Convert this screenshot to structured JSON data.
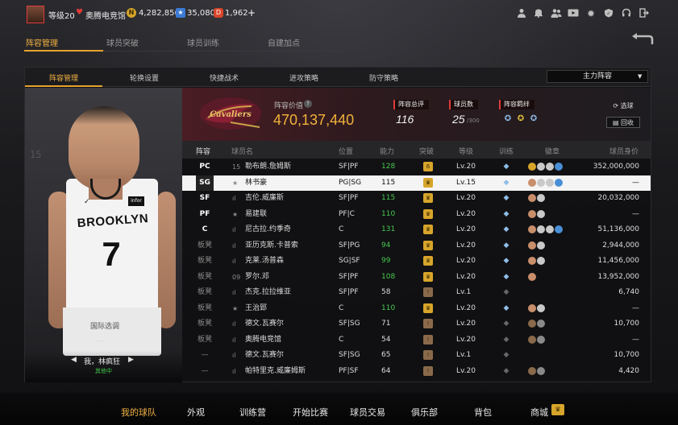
{
  "topbar": {
    "level": "等级20",
    "club_name": "奥腾电竞馆",
    "coins": "4,282,856",
    "gems": "35,080",
    "tickets": "1,962",
    "plus": "+",
    "icons": [
      "profile-icon",
      "bell-icon",
      "friends-icon",
      "video-icon",
      "gear-icon",
      "service-icon",
      "headset-icon",
      "exit-icon"
    ]
  },
  "main_tabs": [
    "阵容管理",
    "球员突破",
    "球员训练",
    "自建加点"
  ],
  "sub_tabs": [
    "阵容管理",
    "轮换设置",
    "快捷战术",
    "进攻策略",
    "防守策略"
  ],
  "dropdown": {
    "value": "主力阵容"
  },
  "player": {
    "name": "我，林疯狂",
    "status": "其他中",
    "shorts_text": "国际选调",
    "dash": "—"
  },
  "team": {
    "value_label": "阵容价值",
    "value": "470,137,440",
    "rating_label": "阵容总评",
    "rating": "116",
    "count_label": "球员数",
    "count": "25",
    "count_max": "/300",
    "talent_label": "阵容羁绊",
    "btn_select": "选球",
    "btn_recycle": "回收"
  },
  "columns": [
    "阵容",
    "球员名",
    "位置",
    "能力",
    "突破",
    "等级",
    "训练",
    "徽章",
    "球员身价"
  ],
  "rows": [
    {
      "pos": "PC",
      "name": "勒布朗.詹姆斯",
      "prefix": "15",
      "posn": "SF|PF",
      "ovr": "128",
      "ovr_green": true,
      "brk": "6",
      "brk_color": "#d7a52a",
      "lvl": "Lv.20",
      "talent": "#8fbde8",
      "emb": [
        "#d7a52a",
        "#c9c9c9",
        "#c9c9c9",
        "#4a8fd6"
      ],
      "price": "352,000,000"
    },
    {
      "pos": "SG",
      "name": "林书豪",
      "prefix": "★",
      "posn": "PG|SG",
      "ovr": "115",
      "ovr_green": false,
      "brk": "♛",
      "brk_color": "#d7a52a",
      "lvl": "Lv.15",
      "talent": "#8fbde8",
      "emb": [
        "#c98e6a",
        "#c9c9c9",
        "#c9c9c9",
        "#4a8fd6"
      ],
      "price": "—",
      "selected": true
    },
    {
      "pos": "SF",
      "name": "吉伦.威廉斯",
      "prefix": "ıl",
      "posn": "SF|PF",
      "ovr": "115",
      "ovr_green": true,
      "brk": "♛",
      "brk_color": "#d7a52a",
      "lvl": "Lv.20",
      "talent": "#8fbde8",
      "emb": [
        "#c98e6a",
        "#c9c9c9"
      ],
      "price": "20,032,000"
    },
    {
      "pos": "PF",
      "name": "易建联",
      "prefix": "★",
      "posn": "PF|C",
      "ovr": "110",
      "ovr_green": true,
      "brk": "♛",
      "brk_color": "#d7a52a",
      "lvl": "Lv.20",
      "talent": "#8fbde8",
      "emb": [
        "#c98e6a",
        "#c9c9c9"
      ],
      "price": "—"
    },
    {
      "pos": "C",
      "name": "尼古拉.约季奇",
      "prefix": "ıl",
      "posn": "C",
      "ovr": "131",
      "ovr_green": true,
      "brk": "♛",
      "brk_color": "#d7a52a",
      "lvl": "Lv.20",
      "talent": "#8fbde8",
      "emb": [
        "#c98e6a",
        "#c9c9c9",
        "#c9c9c9",
        "#4a8fd6"
      ],
      "price": "51,136,000"
    },
    {
      "pos": "板凳",
      "name": "亚历克斯.卡普索",
      "prefix": "ıl",
      "posn": "SF|PG",
      "ovr": "94",
      "ovr_green": true,
      "brk": "♛",
      "brk_color": "#d7a52a",
      "lvl": "Lv.20",
      "talent": "#8fbde8",
      "emb": [
        "#c98e6a",
        "#c9c9c9"
      ],
      "price": "2,944,000"
    },
    {
      "pos": "板凳",
      "name": "克莱.汤普森",
      "prefix": "ıl",
      "posn": "SG|SF",
      "ovr": "99",
      "ovr_green": true,
      "brk": "♛",
      "brk_color": "#d7a52a",
      "lvl": "Lv.20",
      "talent": "#8fbde8",
      "emb": [
        "#c98e6a",
        "#c9c9c9"
      ],
      "price": "11,456,000"
    },
    {
      "pos": "板凳",
      "name": "罗尔.邓",
      "prefix": "09",
      "posn": "SF|PF",
      "ovr": "108",
      "ovr_green": true,
      "brk": "♛",
      "brk_color": "#d7a52a",
      "lvl": "Lv.20",
      "talent": "#8fbde8",
      "emb": [
        "#c98e6a"
      ],
      "price": "13,952,000"
    },
    {
      "pos": "板凳",
      "name": "杰克.拉拉维亚",
      "prefix": "ıl",
      "posn": "SF|PF",
      "ovr": "58",
      "ovr_green": false,
      "brk": "!",
      "brk_color": "#8a6a4a",
      "lvl": "Lv.1",
      "talent": "#666666",
      "emb": [],
      "price": "6,740"
    },
    {
      "pos": "板凳",
      "name": "王治郅",
      "prefix": "★",
      "posn": "C",
      "ovr": "110",
      "ovr_green": true,
      "brk": "♛",
      "brk_color": "#d7a52a",
      "lvl": "Lv.20",
      "talent": "#8fbde8",
      "emb": [
        "#c98e6a",
        "#c9c9c9"
      ],
      "price": "—"
    },
    {
      "pos": "板凳",
      "name": "德文.瓦赛尔",
      "prefix": "ıl",
      "posn": "SF|SG",
      "ovr": "71",
      "ovr_green": false,
      "brk": "!",
      "brk_color": "#8a6a4a",
      "lvl": "Lv.20",
      "talent": "#666666",
      "emb": [
        "#8a6a4a",
        "#8a8a8a"
      ],
      "price": "10,700"
    },
    {
      "pos": "板凳",
      "name": "奥腾电竞馆",
      "prefix": "ıl",
      "posn": "C",
      "ovr": "54",
      "ovr_green": false,
      "brk": "!",
      "brk_color": "#8a6a4a",
      "lvl": "Lv.20",
      "talent": "#666666",
      "emb": [
        "#8a6a4a",
        "#8a8a8a"
      ],
      "price": "—"
    },
    {
      "pos": "—",
      "name": "德文.瓦赛尔",
      "prefix": "ıl",
      "posn": "SF|SG",
      "ovr": "65",
      "ovr_green": false,
      "brk": "!",
      "brk_color": "#8a6a4a",
      "lvl": "Lv.1",
      "talent": "#666666",
      "emb": [],
      "price": "10,700"
    },
    {
      "pos": "—",
      "name": "帕特里克.威廉姆斯",
      "prefix": "ıl",
      "posn": "PF|SF",
      "ovr": "64",
      "ovr_green": false,
      "brk": "!",
      "brk_color": "#8a6a4a",
      "lvl": "Lv.20",
      "talent": "#666666",
      "emb": [
        "#8a6a4a",
        "#8a8a8a"
      ],
      "price": "4,420"
    }
  ],
  "bottom_nav": [
    "我的球队",
    "外观",
    "训练营",
    "开始比赛",
    "球员交易",
    "俱乐部",
    "背包",
    "商城"
  ],
  "colors": {
    "accent": "#e6a32e",
    "positive": "#46c84e",
    "brand": "#e13a3a"
  }
}
